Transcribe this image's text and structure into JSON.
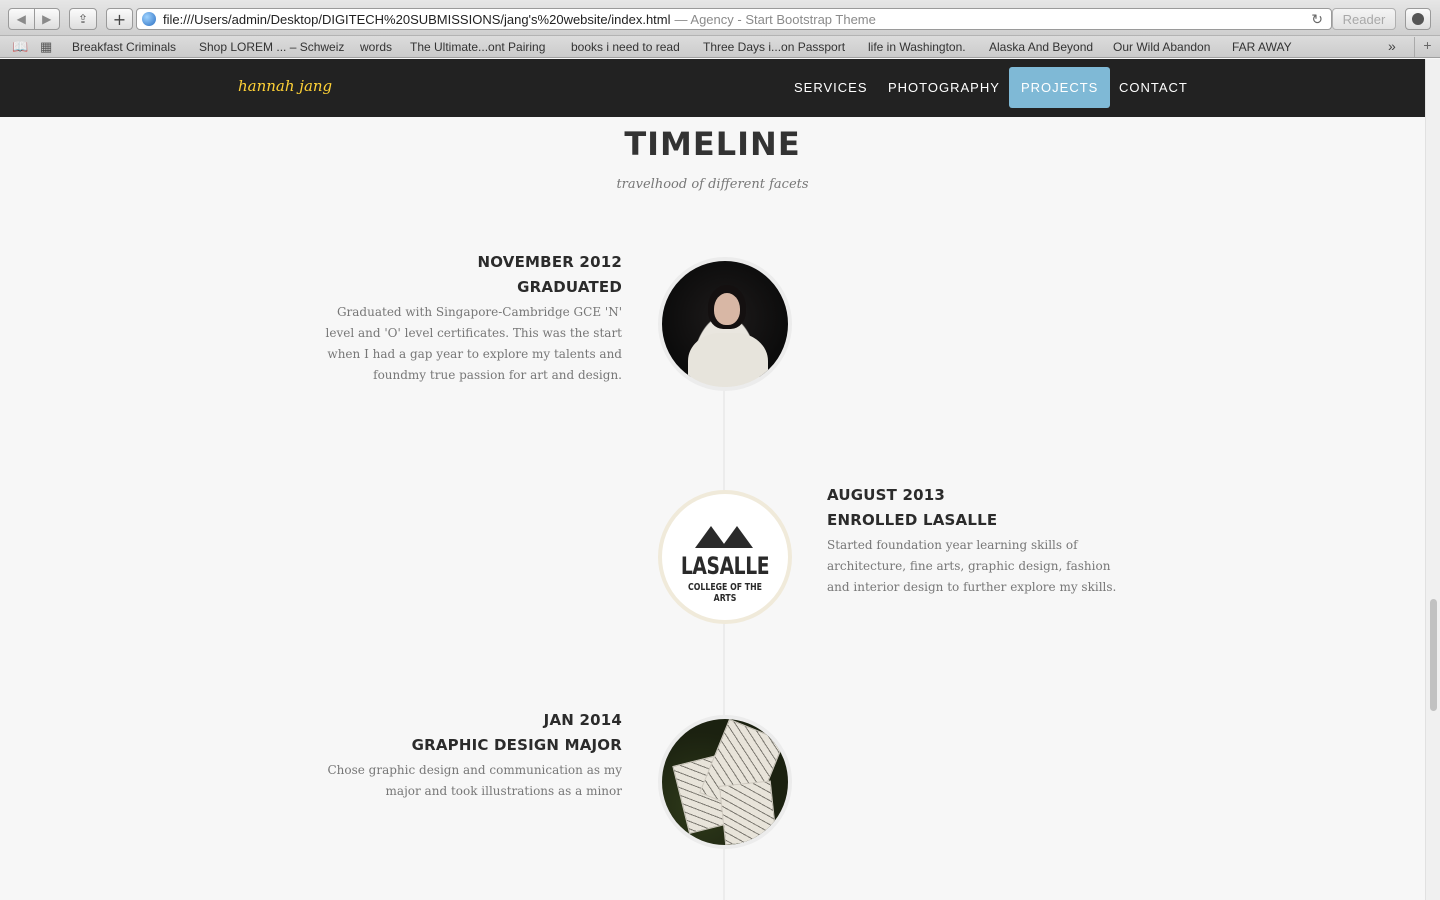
{
  "browser": {
    "url": "file:///Users/admin/Desktop/DIGITECH%20SUBMISSIONS/jang's%20website/index.html",
    "page_title": "— Agency - Start Bootstrap Theme",
    "reader_label": "Reader",
    "bookmarks": [
      "Breakfast Criminals",
      "Shop LOREM ... – Schweiz",
      "words",
      "The Ultimate...ont Pairing",
      "books i need to read",
      "Three Days i...on Passport",
      "life in Washington.",
      "Alaska And Beyond",
      "Our Wild Abandon",
      "FAR AWAY"
    ]
  },
  "site": {
    "logo": "hannah jang",
    "nav": [
      "SERVICES",
      "PHOTOGRAPHY",
      "PROJECTS",
      "CONTACT"
    ],
    "active_nav": "PROJECTS",
    "accent_color": "#7fb9d6",
    "logo_color": "#fed136"
  },
  "timeline": {
    "title": "TIMELINE",
    "subtitle": "travelhood of different facets",
    "entries": [
      {
        "date": "NOVEMBER 2012",
        "heading": "GRADUATED",
        "description": "Graduated with Singapore-Cambridge GCE 'N' level and 'O' level certificates. This was the start when I had a gap year to explore my talents and foundmy true passion for art and design.",
        "image": "portrait-photo"
      },
      {
        "date": "AUGUST 2013",
        "heading": "ENROLLED LASALLE",
        "description": "Started foundation year learning skills of architecture, fine arts, graphic design, fashion and interior design to further explore my skills.",
        "image": "lasalle-logo",
        "logo_title": "LASALLE",
        "logo_subtitle": "COLLEGE OF THE ARTS"
      },
      {
        "date": "JAN 2014",
        "heading": "GRAPHIC DESIGN MAJOR",
        "description": "Chose graphic design and communication as my major and took illustrations as a minor",
        "image": "illustration-cards-photo"
      }
    ]
  }
}
